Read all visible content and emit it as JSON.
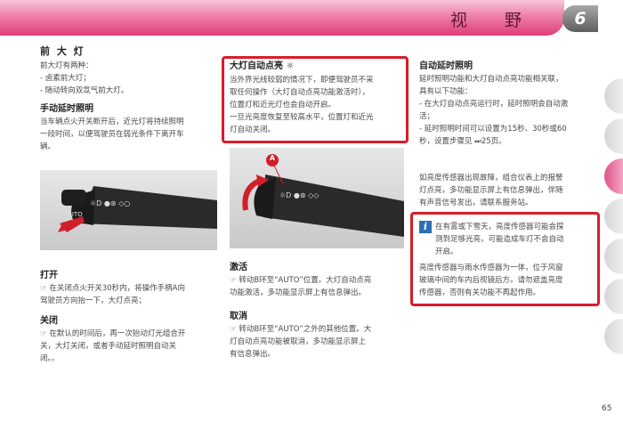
{
  "header": {
    "title": "视 野",
    "chapter": "6"
  },
  "left": {
    "h1": "前 大 灯",
    "p1": "前大灯有两种：\n- 卤素前大灯；\n- 随动转向双氙气前大灯。",
    "h2": "手动延时照明",
    "p2": "当车辆点火开关断开后，近光灯将持续照明\n一段时间，以便驾驶员在弱光条件下离开车\n辆。",
    "h3": "打开",
    "p3": "☞ 在关闭点火开关30秒内，将操作手柄A向\n    驾驶员方向抬一下，大灯点亮；",
    "h4": "关闭",
    "p4": "☞ 在默认的时间后，再一次抬动灯光组合开\n    关，大灯关闭，或者手动延时照明自动关\n    闭。。"
  },
  "middle": {
    "h1": "大灯自动点亮 ☼",
    "p1": "当外界光线较弱的情况下，即便驾驶员不采\n取任何操作（大灯自动点亮功能激活时），\n位置灯和近光灯也会自动开启。\n一旦光亮度恢复至较高水平，位置灯和近光\n灯自动关闭。",
    "marker": "A",
    "h2": "激活",
    "p2": "☞ 转动B环至“AUTO”位置。大灯自动点亮\n    功能激活，多功能显示屏上有信息弹出。",
    "h3": "取消",
    "p3": "☞ 转动B环至“AUTO”之外的其他位置。大\n    灯自动点亮功能被取消，多功能显示屏上\n    有信息弹出。"
  },
  "right": {
    "h1": "自动延时照明",
    "p1": "延时照明功能和大灯自动点亮功能相关联，\n具有以下功能：\n- 在大灯自动点亮运行时，延时照明会自动激\n  活；\n- 延时照明时间可以设置为15秒、30秒或60\n  秒，设置步骤见 ⏭25页。",
    "p2": "如亮度传感器出现故障，组合仪表上的报警\n灯点亮，多功能显示屏上有信息弹出，伴随\n有声音信号发出，请联系服务站。",
    "info_icon": "i",
    "note1": "在有雾或下雪天，亮度传感器可能会探\n测到足够光亮，可能造成车灯不会自动\n开启。",
    "note2": "亮度传感器与雨水传感器为一体，位于风窗\n玻璃中间的车内后视镜后方。请勿遮盖亮度\n传感器，否则有关功能不再起作用。"
  },
  "page_number": "65"
}
